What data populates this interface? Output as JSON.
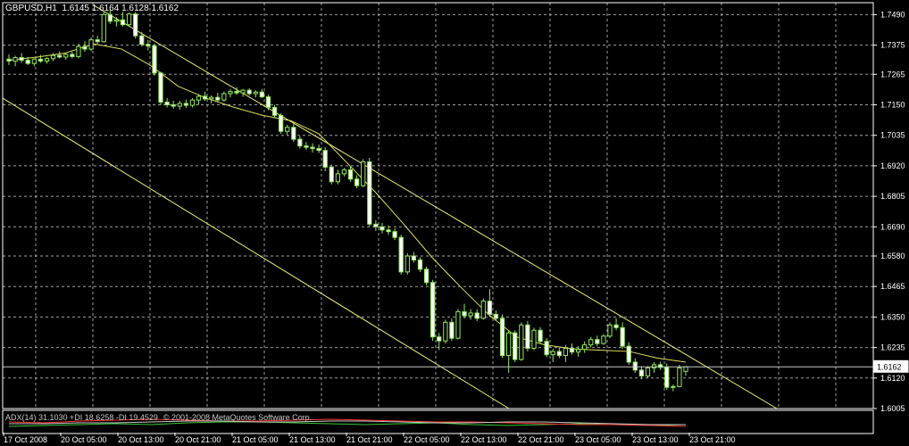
{
  "window": {
    "symbol_label": "GBPUSD,H1",
    "ohlc_text": "1.6145 1.6164 1.6128 1.6162",
    "current_price_label": "1.6162"
  },
  "indicator": {
    "adx_label": "ADX(14) 31.1030 +DI 18.6258 -DI 19.4529",
    "copyright": "© 2001-2008 MetaQuotes Software Corp."
  },
  "colors": {
    "background": "#000000",
    "grid": "#c8c8c8",
    "bull_candle": "#000000",
    "bull_outline": "#8fe85a",
    "bear_candle": "#ffffff",
    "wick": "#8fe85a",
    "moving_average": "#e0e060",
    "channel_lines": "#f0f07a",
    "price_line": "#c8c8c8",
    "adx_main": "#c8c8c8",
    "adx_plus": "#3ac83a",
    "adx_minus": "#ff3030"
  },
  "chart_data": {
    "type": "candlestick",
    "title": "GBPUSD,H1",
    "y_ticks": [
      "1.7490",
      "1.7375",
      "1.7265",
      "1.7150",
      "1.7035",
      "1.6920",
      "1.6805",
      "1.6690",
      "1.6580",
      "1.6465",
      "1.6350",
      "1.6235",
      "1.6120",
      "1.6005"
    ],
    "ylim": [
      1.6005,
      1.7535
    ],
    "x_ticks": [
      "17 Oct 2008",
      "20 Oct 05:00",
      "20 Oct 13:00",
      "20 Oct 21:00",
      "21 Oct 05:00",
      "21 Oct 13:00",
      "21 Oct 21:00",
      "22 Oct 05:00",
      "22 Oct 13:00",
      "22 Oct 21:00",
      "23 Oct 05:00",
      "23 Oct 13:00",
      "23 Oct 21:00"
    ],
    "grid": true,
    "current_price": 1.6162,
    "candles": [
      [
        1.7322,
        1.734,
        1.73,
        1.7315
      ],
      [
        1.7315,
        1.7335,
        1.7295,
        1.7328
      ],
      [
        1.7328,
        1.7345,
        1.7308,
        1.7318
      ],
      [
        1.7318,
        1.733,
        1.73,
        1.7306
      ],
      [
        1.7306,
        1.7325,
        1.7295,
        1.7322
      ],
      [
        1.7322,
        1.7338,
        1.7308,
        1.7315
      ],
      [
        1.7315,
        1.733,
        1.7305,
        1.7324
      ],
      [
        1.7324,
        1.7345,
        1.7315,
        1.7336
      ],
      [
        1.7336,
        1.7352,
        1.7325,
        1.733
      ],
      [
        1.733,
        1.7345,
        1.732,
        1.734
      ],
      [
        1.734,
        1.735,
        1.7325,
        1.7332
      ],
      [
        1.7332,
        1.738,
        1.7325,
        1.737
      ],
      [
        1.737,
        1.739,
        1.735,
        1.736
      ],
      [
        1.736,
        1.7405,
        1.7352,
        1.7395
      ],
      [
        1.7395,
        1.741,
        1.738,
        1.7388
      ],
      [
        1.7388,
        1.7505,
        1.7385,
        1.749
      ],
      [
        1.749,
        1.751,
        1.7455,
        1.7465
      ],
      [
        1.7465,
        1.748,
        1.7445,
        1.747
      ],
      [
        1.747,
        1.75,
        1.7445,
        1.7452
      ],
      [
        1.7452,
        1.7498,
        1.7448,
        1.7492
      ],
      [
        1.7492,
        1.75,
        1.74,
        1.741
      ],
      [
        1.741,
        1.7425,
        1.737,
        1.7378
      ],
      [
        1.7378,
        1.7395,
        1.7355,
        1.7372
      ],
      [
        1.7372,
        1.738,
        1.726,
        1.727
      ],
      [
        1.727,
        1.7275,
        1.715,
        1.716
      ],
      [
        1.716,
        1.7175,
        1.714,
        1.715
      ],
      [
        1.715,
        1.7165,
        1.7135,
        1.7145
      ],
      [
        1.7145,
        1.7165,
        1.7132,
        1.7155
      ],
      [
        1.7155,
        1.717,
        1.7138,
        1.7148
      ],
      [
        1.7148,
        1.7175,
        1.714,
        1.7168
      ],
      [
        1.7168,
        1.719,
        1.715,
        1.7182
      ],
      [
        1.7182,
        1.72,
        1.7165,
        1.7172
      ],
      [
        1.7172,
        1.7185,
        1.7155,
        1.7178
      ],
      [
        1.7178,
        1.7195,
        1.716,
        1.7168
      ],
      [
        1.7168,
        1.72,
        1.7162,
        1.7192
      ],
      [
        1.7192,
        1.721,
        1.7178,
        1.72
      ],
      [
        1.72,
        1.7215,
        1.7188,
        1.7195
      ],
      [
        1.7195,
        1.721,
        1.718,
        1.7205
      ],
      [
        1.7205,
        1.7212,
        1.7185,
        1.7192
      ],
      [
        1.7192,
        1.7205,
        1.7178,
        1.7198
      ],
      [
        1.7198,
        1.721,
        1.7175,
        1.718
      ],
      [
        1.718,
        1.7188,
        1.713,
        1.714
      ],
      [
        1.714,
        1.715,
        1.71,
        1.711
      ],
      [
        1.711,
        1.7118,
        1.704,
        1.705
      ],
      [
        1.705,
        1.7075,
        1.7035,
        1.7065
      ],
      [
        1.7065,
        1.708,
        1.701,
        1.702
      ],
      [
        1.702,
        1.7032,
        1.6985,
        1.6995
      ],
      [
        1.6995,
        1.701,
        1.698,
        1.699
      ],
      [
        1.699,
        1.7005,
        1.697,
        1.6985
      ],
      [
        1.6985,
        1.7,
        1.6968,
        1.6978
      ],
      [
        1.6978,
        1.699,
        1.69,
        1.6915
      ],
      [
        1.6915,
        1.6925,
        1.685,
        1.686
      ],
      [
        1.686,
        1.6905,
        1.685,
        1.689
      ],
      [
        1.689,
        1.6912,
        1.688,
        1.6905
      ],
      [
        1.6905,
        1.692,
        1.686,
        1.687
      ],
      [
        1.687,
        1.6885,
        1.6835,
        1.6845
      ],
      [
        1.6845,
        1.6945,
        1.684,
        1.6935
      ],
      [
        1.6935,
        1.695,
        1.669,
        1.67
      ],
      [
        1.67,
        1.6715,
        1.6675,
        1.669
      ],
      [
        1.669,
        1.6705,
        1.6665,
        1.6678
      ],
      [
        1.6678,
        1.6695,
        1.666,
        1.6672
      ],
      [
        1.6672,
        1.6685,
        1.664,
        1.665
      ],
      [
        1.665,
        1.666,
        1.651,
        1.652
      ],
      [
        1.652,
        1.659,
        1.651,
        1.658
      ],
      [
        1.658,
        1.6595,
        1.6555,
        1.6565
      ],
      [
        1.6565,
        1.6575,
        1.652,
        1.653
      ],
      [
        1.653,
        1.654,
        1.647,
        1.648
      ],
      [
        1.648,
        1.649,
        1.626,
        1.6275
      ],
      [
        1.6275,
        1.629,
        1.6225,
        1.626
      ],
      [
        1.626,
        1.634,
        1.625,
        1.633
      ],
      [
        1.633,
        1.6345,
        1.626,
        1.627
      ],
      [
        1.627,
        1.638,
        1.6265,
        1.637
      ],
      [
        1.637,
        1.64,
        1.6345,
        1.6355
      ],
      [
        1.6355,
        1.638,
        1.634,
        1.6365
      ],
      [
        1.6365,
        1.638,
        1.6335,
        1.6345
      ],
      [
        1.6345,
        1.642,
        1.634,
        1.641
      ],
      [
        1.641,
        1.6455,
        1.635,
        1.636
      ],
      [
        1.636,
        1.6375,
        1.6335,
        1.6345
      ],
      [
        1.6345,
        1.636,
        1.6195,
        1.6205
      ],
      [
        1.6205,
        1.63,
        1.614,
        1.629
      ],
      [
        1.629,
        1.63,
        1.618,
        1.619
      ],
      [
        1.619,
        1.633,
        1.6185,
        1.632
      ],
      [
        1.632,
        1.6335,
        1.622,
        1.6232
      ],
      [
        1.6232,
        1.631,
        1.6225,
        1.63
      ],
      [
        1.63,
        1.6312,
        1.6248,
        1.6258
      ],
      [
        1.6258,
        1.627,
        1.6198,
        1.6208
      ],
      [
        1.6208,
        1.623,
        1.618,
        1.622
      ],
      [
        1.622,
        1.6235,
        1.6195,
        1.6205
      ],
      [
        1.6205,
        1.6245,
        1.618,
        1.6232
      ],
      [
        1.6232,
        1.625,
        1.6208,
        1.6218
      ],
      [
        1.6218,
        1.624,
        1.62,
        1.6228
      ],
      [
        1.6228,
        1.6258,
        1.6215,
        1.6245
      ],
      [
        1.6245,
        1.6275,
        1.6235,
        1.6265
      ],
      [
        1.6265,
        1.628,
        1.624,
        1.625
      ],
      [
        1.625,
        1.6285,
        1.6245,
        1.6278
      ],
      [
        1.6278,
        1.633,
        1.627,
        1.632
      ],
      [
        1.632,
        1.6345,
        1.63,
        1.631
      ],
      [
        1.631,
        1.633,
        1.623,
        1.624
      ],
      [
        1.624,
        1.6255,
        1.617,
        1.618
      ],
      [
        1.618,
        1.6195,
        1.614,
        1.615
      ],
      [
        1.615,
        1.6165,
        1.6115,
        1.6128
      ],
      [
        1.6128,
        1.6165,
        1.612,
        1.6158
      ],
      [
        1.6158,
        1.618,
        1.614,
        1.617
      ],
      [
        1.617,
        1.6182,
        1.615,
        1.616
      ],
      [
        1.616,
        1.6175,
        1.6075,
        1.6085
      ],
      [
        1.6085,
        1.6095,
        1.607,
        1.6088
      ],
      [
        1.6088,
        1.617,
        1.6085,
        1.6158
      ],
      [
        1.6145,
        1.6164,
        1.6128,
        1.6162
      ]
    ],
    "moving_average": [
      1.7318,
      1.733,
      1.7345,
      1.738,
      1.736,
      1.73,
      1.722,
      1.7175,
      1.714,
      1.711,
      1.709,
      1.704,
      1.693,
      1.682,
      1.67,
      1.6575,
      1.6465,
      1.636,
      1.6275,
      1.6245,
      1.623,
      1.6225,
      1.622,
      1.6195,
      1.618
    ],
    "channel_upper": [
      [
        105,
        1.7525
      ],
      [
        770,
        1.6205
      ],
      [
        870,
        1.6005
      ]
    ],
    "channel_lower": [
      [
        3,
        1.7175
      ],
      [
        570,
        1.6005
      ]
    ]
  }
}
